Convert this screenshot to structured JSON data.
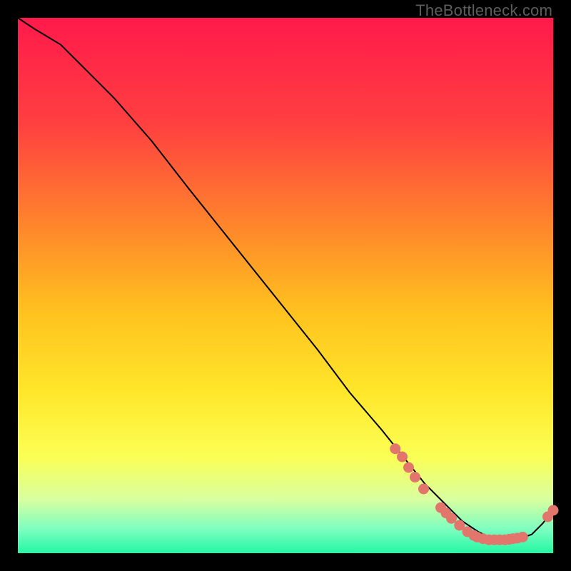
{
  "watermark": "TheBottleneck.com",
  "colors": {
    "background": "#000000",
    "gradient_stops": [
      {
        "offset": 0.0,
        "color": "#ff1a4b"
      },
      {
        "offset": 0.2,
        "color": "#ff4040"
      },
      {
        "offset": 0.4,
        "color": "#ff8a2a"
      },
      {
        "offset": 0.55,
        "color": "#ffc21f"
      },
      {
        "offset": 0.7,
        "color": "#ffe72a"
      },
      {
        "offset": 0.82,
        "color": "#fbff55"
      },
      {
        "offset": 0.9,
        "color": "#d8ffa0"
      },
      {
        "offset": 0.955,
        "color": "#7dfec0"
      },
      {
        "offset": 1.0,
        "color": "#24f7a4"
      }
    ],
    "curve": "#000000",
    "dot": "#e2766d"
  },
  "chart_data": {
    "type": "line",
    "title": "",
    "xlabel": "",
    "ylabel": "",
    "xlim": [
      0,
      100
    ],
    "ylim": [
      0,
      100
    ],
    "series": [
      {
        "name": "curve",
        "x": [
          0,
          3,
          8,
          12,
          18,
          25,
          32,
          40,
          48,
          56,
          62,
          68,
          72,
          76,
          80,
          83,
          86,
          89,
          92,
          94,
          96,
          98,
          100
        ],
        "y": [
          100,
          98,
          95,
          91,
          85,
          77,
          68,
          58,
          48,
          38,
          30,
          23,
          18,
          13,
          9,
          6,
          4,
          2.5,
          2.5,
          2.8,
          3.5,
          5.5,
          8
        ]
      }
    ],
    "points": [
      {
        "x": 70.5,
        "y": 19.5
      },
      {
        "x": 71.8,
        "y": 18.0
      },
      {
        "x": 73.0,
        "y": 16.0
      },
      {
        "x": 74.2,
        "y": 14.2
      },
      {
        "x": 75.8,
        "y": 12.0
      },
      {
        "x": 79.0,
        "y": 8.5
      },
      {
        "x": 80.0,
        "y": 7.5
      },
      {
        "x": 81.0,
        "y": 6.5
      },
      {
        "x": 82.5,
        "y": 5.2
      },
      {
        "x": 84.0,
        "y": 4.0
      },
      {
        "x": 85.2,
        "y": 3.3
      },
      {
        "x": 85.8,
        "y": 3.0
      },
      {
        "x": 86.9,
        "y": 2.7
      },
      {
        "x": 88.0,
        "y": 2.5
      },
      {
        "x": 89.0,
        "y": 2.5
      },
      {
        "x": 90.0,
        "y": 2.5
      },
      {
        "x": 91.0,
        "y": 2.5
      },
      {
        "x": 91.8,
        "y": 2.6
      },
      {
        "x": 92.5,
        "y": 2.7
      },
      {
        "x": 93.3,
        "y": 2.8
      },
      {
        "x": 94.3,
        "y": 3.0
      },
      {
        "x": 99.0,
        "y": 6.8
      },
      {
        "x": 100.0,
        "y": 8.0
      }
    ]
  }
}
